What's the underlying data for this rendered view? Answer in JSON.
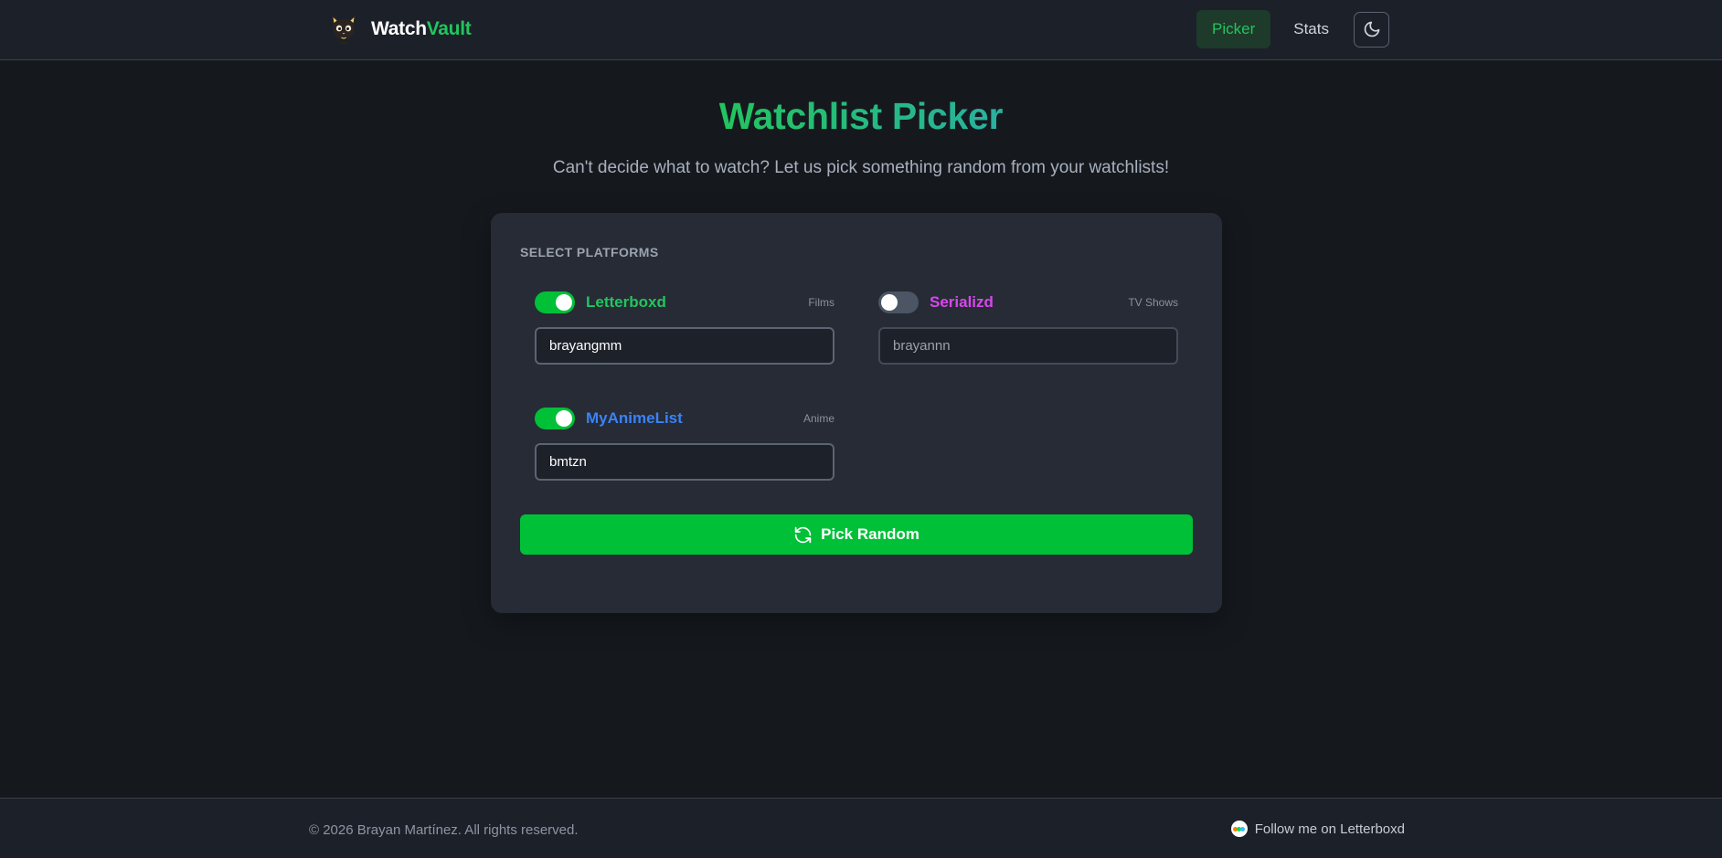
{
  "header": {
    "brand_part1": "Watch",
    "brand_part2": "Vault",
    "nav": [
      {
        "label": "Picker",
        "active": true
      },
      {
        "label": "Stats",
        "active": false
      }
    ],
    "theme_toggle_icon": "moon-icon"
  },
  "hero": {
    "title": "Watchlist Picker",
    "subtitle": "Can't decide what to watch? Let us pick something random from your watchlists!"
  },
  "card": {
    "section_label": "SELECT PLATFORMS",
    "platforms": [
      {
        "name": "Letterboxd",
        "type": "Films",
        "enabled": true,
        "username": "brayangmm",
        "color": "#22c55e"
      },
      {
        "name": "Serializd",
        "type": "TV Shows",
        "enabled": false,
        "username": "brayannn",
        "color": "#d946ef"
      },
      {
        "name": "MyAnimeList",
        "type": "Anime",
        "enabled": true,
        "username": "bmtzn",
        "color": "#3b82f6"
      }
    ],
    "pick_button": {
      "label": "Pick Random",
      "icon": "refresh-icon"
    }
  },
  "footer": {
    "copyright": "© 2026 Brayan Martínez. All rights reserved.",
    "follow_label": "Follow me on Letterboxd",
    "follow_icon": "letterboxd-icon"
  },
  "colors": {
    "accent": "#22c55e",
    "button": "#00c037",
    "background": "#15191e",
    "card": "#262b35"
  }
}
